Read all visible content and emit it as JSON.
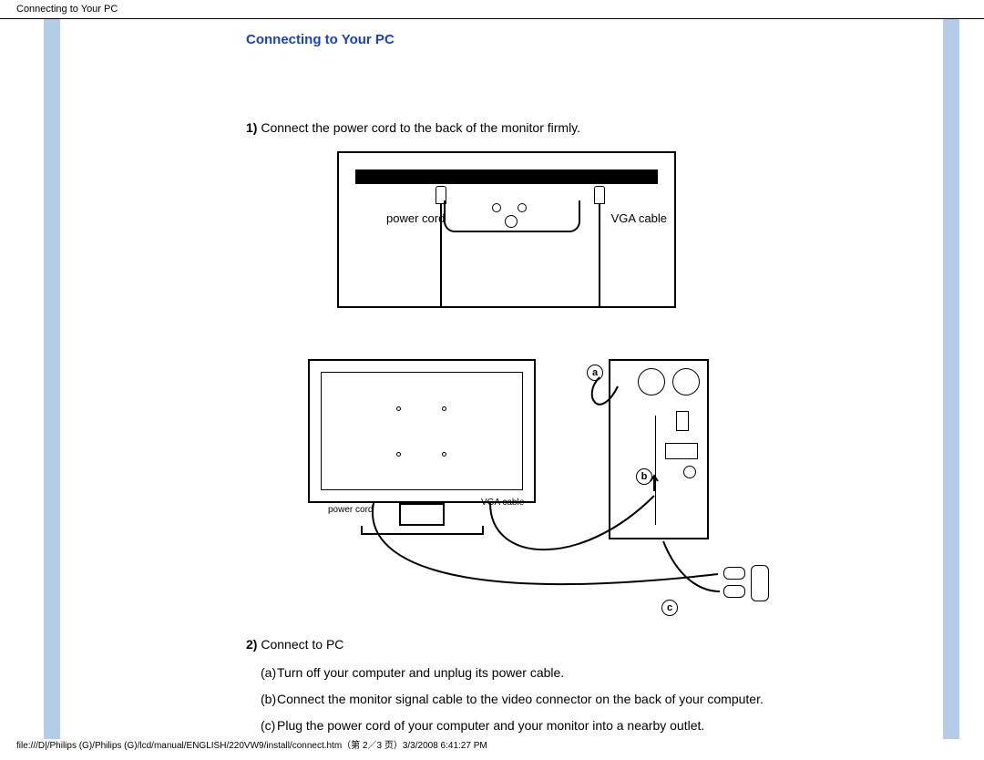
{
  "header": {
    "title": "Connecting to Your PC"
  },
  "main": {
    "heading": "Connecting to Your PC",
    "step1": {
      "num": "1)",
      "text": "Connect the power cord to the back of the monitor firmly."
    },
    "diagram1": {
      "power_label": "power cord",
      "vga_label": "VGA cable"
    },
    "diagram2": {
      "power_label": "power cord",
      "vga_label": "VGA cable",
      "label_a": "a",
      "label_b": "b",
      "label_c": "c"
    },
    "step2": {
      "num": "2)",
      "text": "Connect to PC",
      "items": [
        {
          "letter": "(a)",
          "text": "Turn off your computer and unplug its power cable."
        },
        {
          "letter": "(b)",
          "text": "Connect the monitor signal cable to the video connector on the back of your computer."
        },
        {
          "letter": "(c)",
          "text": "Plug the power cord of your computer and your monitor into a nearby outlet."
        }
      ]
    }
  },
  "footer": {
    "text": "file:///D|/Philips (G)/Philips (G)/lcd/manual/ENGLISH/220VW9/install/connect.htm（第 2／3 页）3/3/2008 6:41:27 PM"
  }
}
